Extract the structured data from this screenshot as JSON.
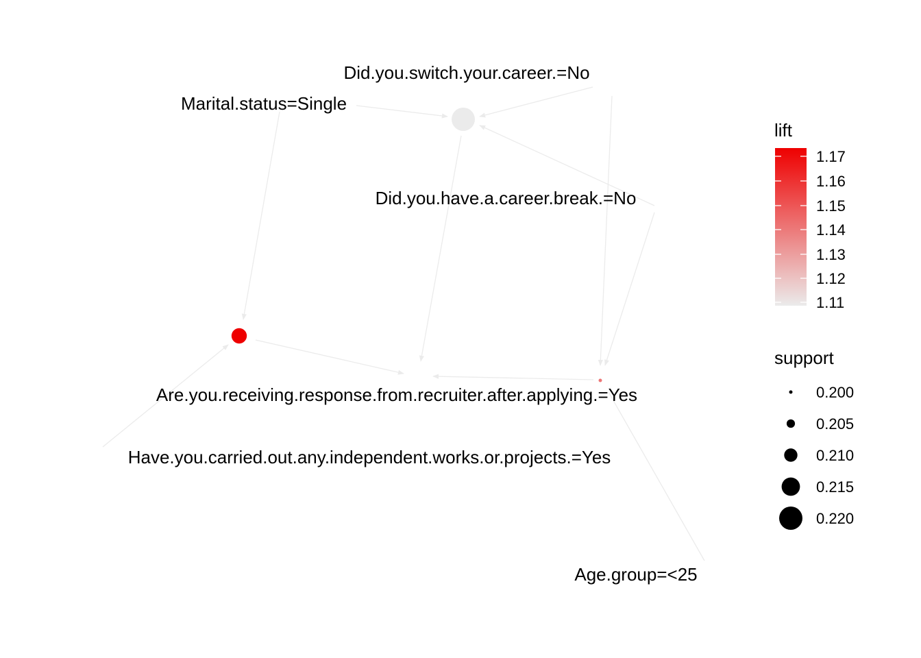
{
  "items": {
    "switch_career": "Did.you.switch.your.career.=No",
    "marital": "Marital.status=Single",
    "career_break": "Did.you.have.a.career.break.=No",
    "recruiter": "Are.you.receiving.response.from.recruiter.after.applying.=Yes",
    "projects": "Have.you.carried.out.any.independent.works.or.projects.=Yes",
    "age": "Age.group=<25"
  },
  "rules": [
    {
      "id": "rule-top",
      "support": 0.22,
      "lift": 1.11
    },
    {
      "id": "rule-left",
      "support": 0.212,
      "lift": 1.17
    },
    {
      "id": "rule-right",
      "support": 0.2,
      "lift": 1.14
    }
  ],
  "legend": {
    "lift_title": "lift",
    "lift_ticks": [
      "1.17",
      "1.16",
      "1.15",
      "1.14",
      "1.13",
      "1.12",
      "1.11"
    ],
    "lift_range": [
      1.11,
      1.17
    ],
    "lift_colors": {
      "low": "#ebebeb",
      "high": "#ee0000"
    },
    "support_title": "support",
    "support_ticks": [
      "0.200",
      "0.205",
      "0.210",
      "0.215",
      "0.220"
    ],
    "support_values": [
      0.2,
      0.205,
      0.21,
      0.215,
      0.22
    ]
  }
}
